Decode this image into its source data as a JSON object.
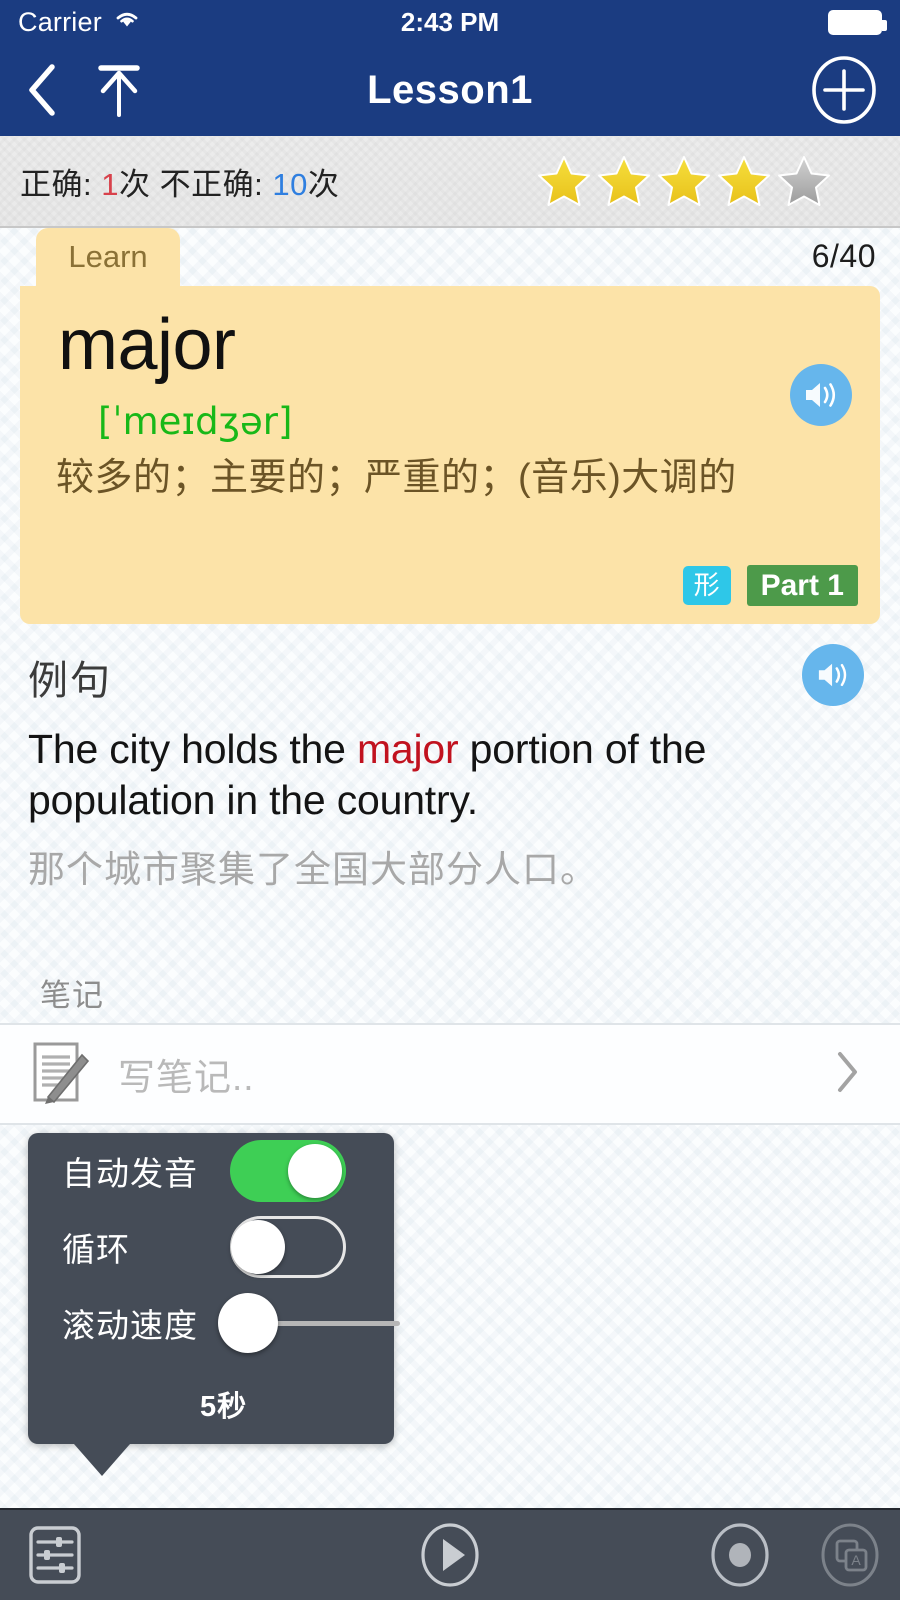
{
  "status_bar": {
    "carrier": "Carrier",
    "wifi_icon": "wifi-icon",
    "time": "2:43 PM",
    "battery_icon": "battery-full-icon"
  },
  "nav_bar": {
    "back_icon": "chevron-left-icon",
    "top_icon": "arrow-up-to-line-icon",
    "title": "Lesson1",
    "add_icon": "plus-circle-icon",
    "background_color": "#1b3c81"
  },
  "stats_bar": {
    "correct_label": "正确: ",
    "correct_count": "1",
    "correct_unit": "次 ",
    "incorrect_label": "不正确: ",
    "incorrect_count": "10",
    "incorrect_unit": "次",
    "correct_color": "#d8414b",
    "incorrect_color": "#2f7fe0",
    "stars_filled": 4,
    "stars_total": 5,
    "star_filled_color": "#e8c11a",
    "star_empty_color": "#b3b3b3"
  },
  "word_card": {
    "tab_label": "Learn",
    "counter": "6/40",
    "word": "major",
    "phonetic": "[ˈmeɪdʒər]",
    "definition": "较多的；主要的；严重的；(音乐)大调的",
    "tag_pos": "形",
    "tag_part": "Part 1",
    "speaker_icon": "speaker-icon",
    "card_color": "#fce3a8",
    "pos_tag_color": "#2ec7e8",
    "part_tag_color": "#4d9a4a",
    "phonetic_color": "#18b818"
  },
  "example": {
    "label": "例句",
    "speaker_icon": "speaker-icon",
    "sentence_before": "The city holds the ",
    "sentence_highlight": "major",
    "sentence_after": " portion of the population in the country.",
    "highlight_color": "#c1121f",
    "translation": "那个城市聚集了全国大部分人口。"
  },
  "notes": {
    "section_label": "笔记",
    "note_icon": "note-pencil-icon",
    "placeholder": "写笔记..",
    "chevron_icon": "chevron-right-icon"
  },
  "settings_popover": {
    "rows": [
      {
        "label": "自动发音",
        "control": "toggle",
        "state": "on"
      },
      {
        "label": "循环",
        "control": "toggle",
        "state": "off"
      },
      {
        "label": "滚动速度",
        "control": "slider",
        "value": "5秒"
      }
    ],
    "speed_value": "5秒",
    "toggle_on_color": "#3ecf55",
    "panel_color": "#454c57"
  },
  "toolbar": {
    "settings_icon": "sliders-icon",
    "play_icon": "play-circle-icon",
    "record_icon": "record-circle-icon",
    "card_icon": "translate-card-icon",
    "background_color": "#454c57"
  }
}
